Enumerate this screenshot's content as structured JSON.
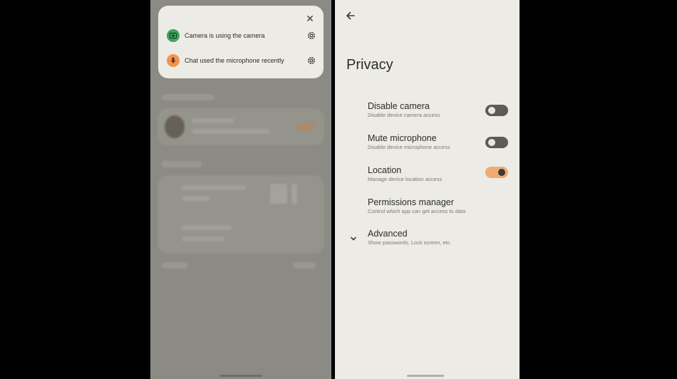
{
  "left": {
    "popup": {
      "close_icon": "close-icon",
      "items": [
        {
          "text": "Camera is using the camera",
          "icon": "camera-icon",
          "color": "#3fa35c"
        },
        {
          "text": "Chat used the microphone recently",
          "icon": "microphone-icon",
          "color": "#f0954e"
        }
      ],
      "settings_icon": "gear-icon"
    }
  },
  "right": {
    "title": "Privacy",
    "back_icon": "back-arrow-icon",
    "settings": [
      {
        "title": "Disable camera",
        "subtitle": "Disable device camera access",
        "toggle": "off"
      },
      {
        "title": "Mute microphone",
        "subtitle": "Disable device microphone access",
        "toggle": "off"
      },
      {
        "title": "Location",
        "subtitle": "Manage device location access",
        "toggle": "on"
      },
      {
        "title": "Permissions manager",
        "subtitle": "Control which app can get access to data"
      },
      {
        "title": "Advanced",
        "subtitle": "Show passwords, Lock screen, etc."
      }
    ],
    "accent_color": "#f0ab72"
  }
}
